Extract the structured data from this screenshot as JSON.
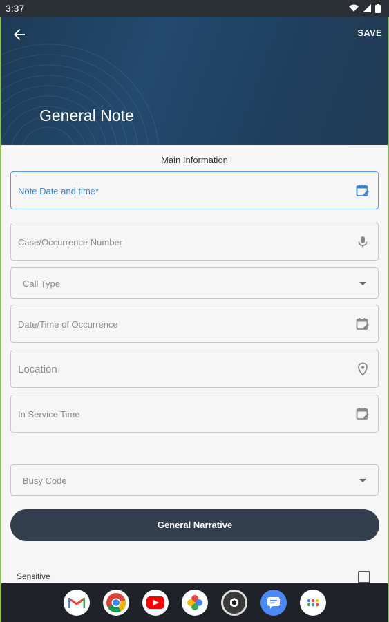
{
  "status": {
    "time": "3:37"
  },
  "header": {
    "title": "General Note",
    "save_label": "SAVE"
  },
  "form": {
    "section_title": "Main Information",
    "fields": [
      {
        "label": "Note Date and time*",
        "icon": "calendar-edit-icon",
        "active": true
      },
      {
        "label": "Case/Occurrence Number",
        "icon": "mic-icon"
      },
      {
        "label": "Call Type",
        "icon": "dropdown-arrow-icon"
      },
      {
        "label": "Date/Time of Occurrence",
        "icon": "calendar-edit-icon"
      },
      {
        "label": "Location",
        "icon": "location-pin-icon"
      },
      {
        "label": "In Service Time",
        "icon": "calendar-edit-icon"
      },
      {
        "label": "Busy Code",
        "icon": "dropdown-arrow-icon"
      }
    ],
    "narrative_button": "General Narrative",
    "sensitive_label": "Sensitive"
  },
  "dock": [
    "gmail-icon",
    "chrome-icon",
    "youtube-icon",
    "photos-icon",
    "camera-app-icon",
    "messages-icon",
    "app-drawer-icon"
  ],
  "colors": {
    "accent": "#3b82d4",
    "header": "#1f3f5e",
    "button": "#333e4f"
  }
}
